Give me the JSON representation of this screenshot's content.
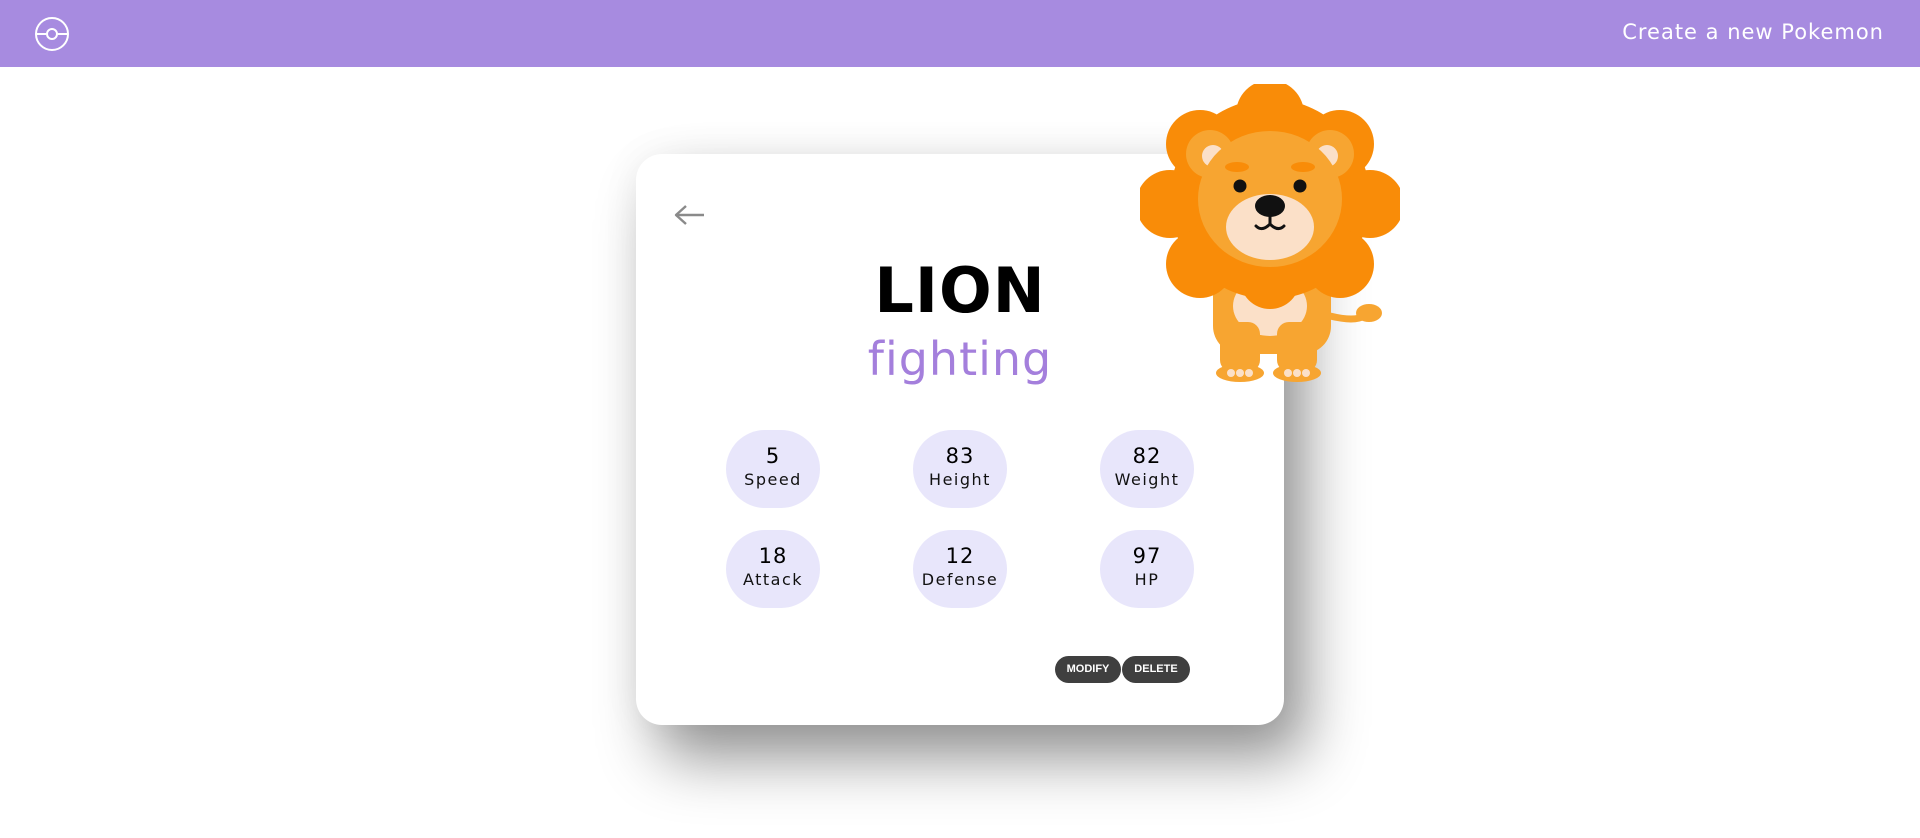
{
  "navbar": {
    "logo_icon": "pokeball-icon",
    "create_link": "Create a new Pokemon",
    "background_color": "#a78be0"
  },
  "detail": {
    "back_icon": "arrow-left-icon",
    "name": "LION",
    "type": "fighting",
    "type_color": "#a47fdc",
    "image_icon": "lion-image",
    "stats": [
      {
        "value": "5",
        "label": "Speed"
      },
      {
        "value": "83",
        "label": "Height"
      },
      {
        "value": "82",
        "label": "Weight"
      },
      {
        "value": "18",
        "label": "Attack"
      },
      {
        "value": "12",
        "label": "Defense"
      },
      {
        "value": "97",
        "label": "HP"
      }
    ],
    "modify_label": "MODIFY",
    "delete_label": "DELETE"
  }
}
